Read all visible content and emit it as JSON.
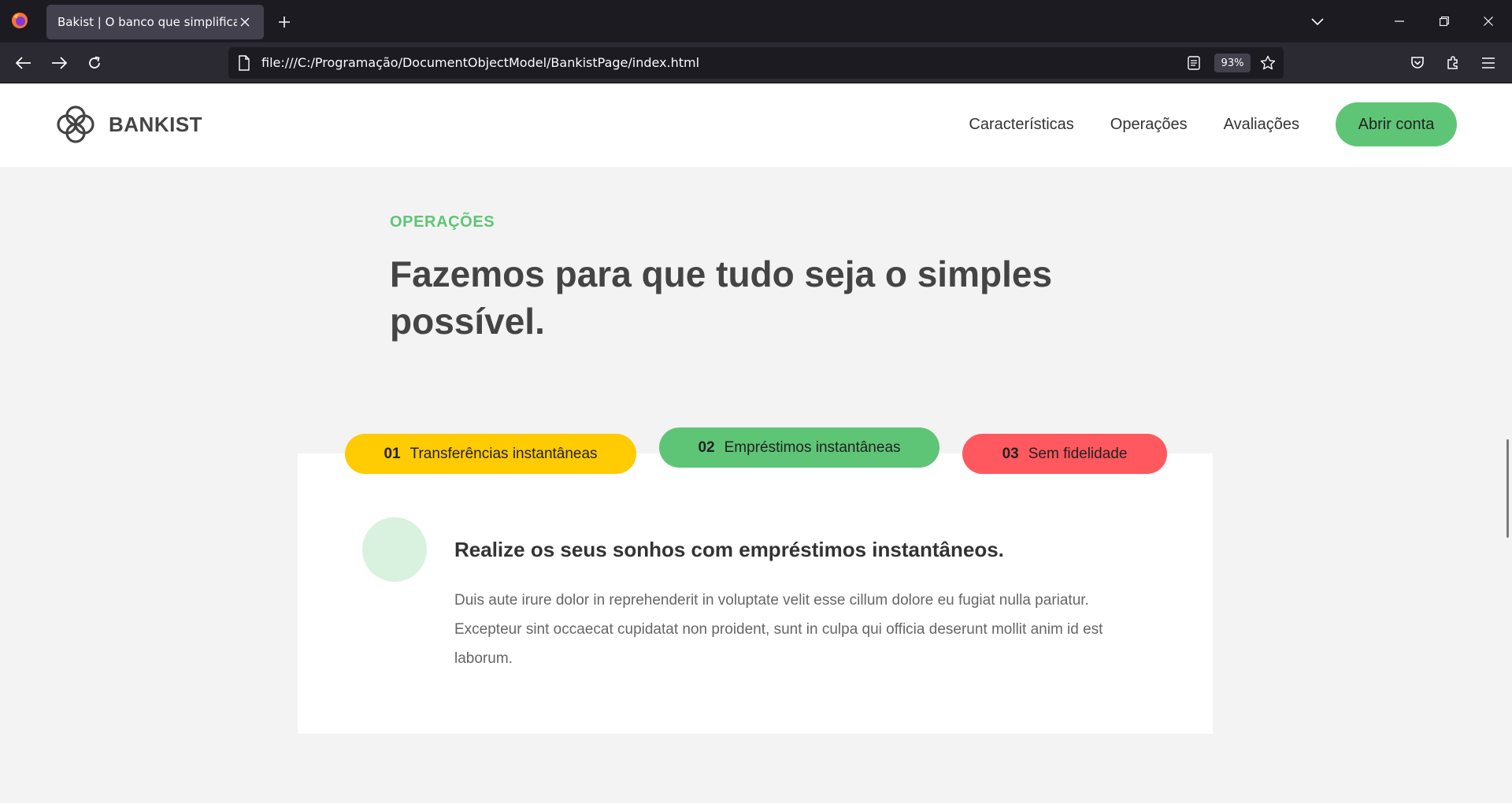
{
  "browser": {
    "tab_title": "Bakist | O banco que simplifica",
    "url": "file:///C:/Programação/DocumentObjectModel/BankistPage/index.html",
    "zoom": "93%"
  },
  "header": {
    "brand": "BANKIST",
    "nav": [
      "Características",
      "Operações",
      "Avaliações"
    ],
    "cta": "Abrir conta"
  },
  "section": {
    "label": "OPERAÇÕES",
    "title": "Fazemos para que tudo seja o simples possível."
  },
  "operations": {
    "tabs": [
      {
        "num": "01",
        "label": "Transferências instantâneas",
        "color": "#ffcb03"
      },
      {
        "num": "02",
        "label": "Empréstimos instantâneas",
        "color": "#5ec576",
        "active": true
      },
      {
        "num": "03",
        "label": "Sem fidelidade",
        "color": "#ff585f"
      }
    ],
    "active_heading": "Realize os seus sonhos com empréstimos instantâneos.",
    "active_text": "Duis aute irure dolor in reprehenderit in voluptate velit esse cillum dolore eu fugiat nulla pariatur. Excepteur sint occaecat cupidatat non proident, sunt in culpa qui officia deserunt mollit anim id est laborum."
  },
  "colors": {
    "accent_green": "#5ec576",
    "accent_yellow": "#ffcb03",
    "accent_red": "#ff585f"
  }
}
